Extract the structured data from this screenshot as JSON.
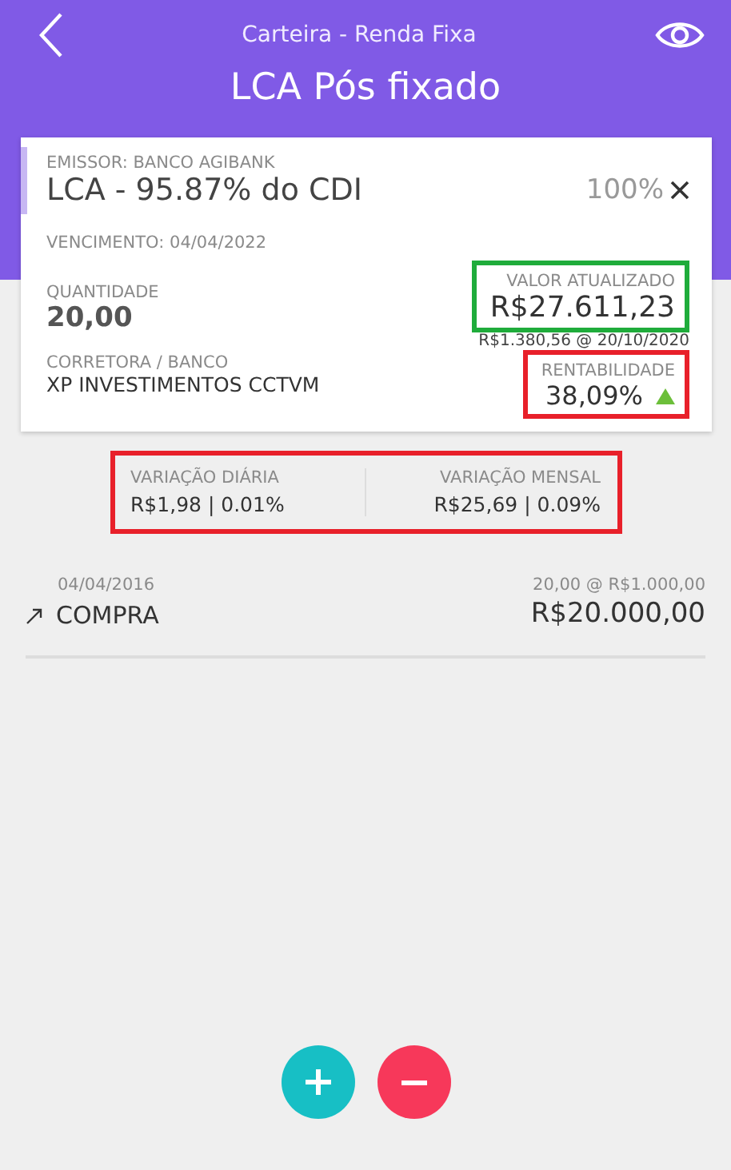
{
  "header": {
    "subtitle": "Carteira - Renda Fixa",
    "title": "LCA Pós fixado"
  },
  "asset": {
    "issuer": "EMISSOR: BANCO AGIBANK",
    "name": "LCA - 95.87% do CDI",
    "share": "100%",
    "maturity": "VENCIMENTO: 04/04/2022",
    "quantity": {
      "label": "QUANTIDADE",
      "value": "20,00"
    },
    "current_value": {
      "label": "VALOR ATUALIZADO",
      "value": "R$27.611,23",
      "unit": "R$1.380,56 @ 20/10/2020",
      "color": "#1fac3b"
    },
    "broker": {
      "label": "CORRETORA / BANCO",
      "value": "XP INVESTIMENTOS CCTVM"
    },
    "return": {
      "label": "RENTABILIDADE",
      "value": "38,09%",
      "rising": true,
      "color": "#e8202a"
    }
  },
  "variation": {
    "color": "#e8202a",
    "items": [
      {
        "label": "VARIAÇÃO DIÁRIA",
        "value": "R$1,98 | 0.01%"
      },
      {
        "label": "VARIAÇÃO MENSAL",
        "value": "R$25,69 | 0.09%"
      }
    ]
  },
  "transactions": [
    {
      "kind": "buy",
      "date": "04/04/2016",
      "type": "COMPRA",
      "detail": "20,00 @ R$1.000,00",
      "amount": "R$20.000,00"
    }
  ]
}
